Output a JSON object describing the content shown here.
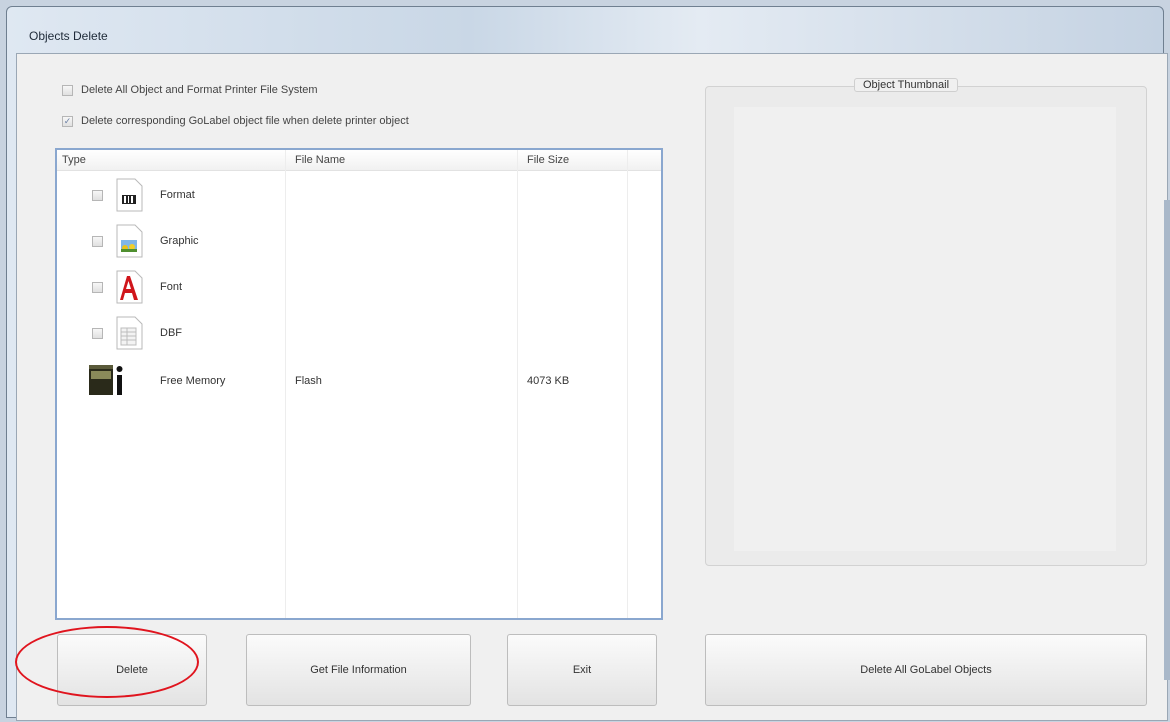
{
  "window": {
    "title": "Objects Delete"
  },
  "options": {
    "delete_all_label": "Delete All Object and Format Printer File System",
    "delete_all_checked": false,
    "delete_golabel_label": "Delete corresponding GoLabel object file when delete printer object",
    "delete_golabel_checked": true
  },
  "list": {
    "columns": [
      "Type",
      "File Name",
      "File Size"
    ],
    "rows": [
      {
        "type": "Format",
        "icon": "format-file-icon",
        "file_name": "",
        "file_size": ""
      },
      {
        "type": "Graphic",
        "icon": "graphic-file-icon",
        "file_name": "",
        "file_size": ""
      },
      {
        "type": "Font",
        "icon": "font-file-icon",
        "file_name": "",
        "file_size": ""
      },
      {
        "type": "DBF",
        "icon": "dbf-file-icon",
        "file_name": "",
        "file_size": ""
      },
      {
        "type": "Free Memory",
        "icon": "memory-info-icon",
        "file_name": "Flash",
        "file_size": "4073 KB"
      }
    ]
  },
  "thumbnail": {
    "label": "Object Thumbnail"
  },
  "buttons": {
    "delete": "Delete",
    "get_info": "Get File Information",
    "exit": "Exit",
    "delete_all_golabel": "Delete All GoLabel Objects"
  },
  "annotation_color": "#e0141e"
}
